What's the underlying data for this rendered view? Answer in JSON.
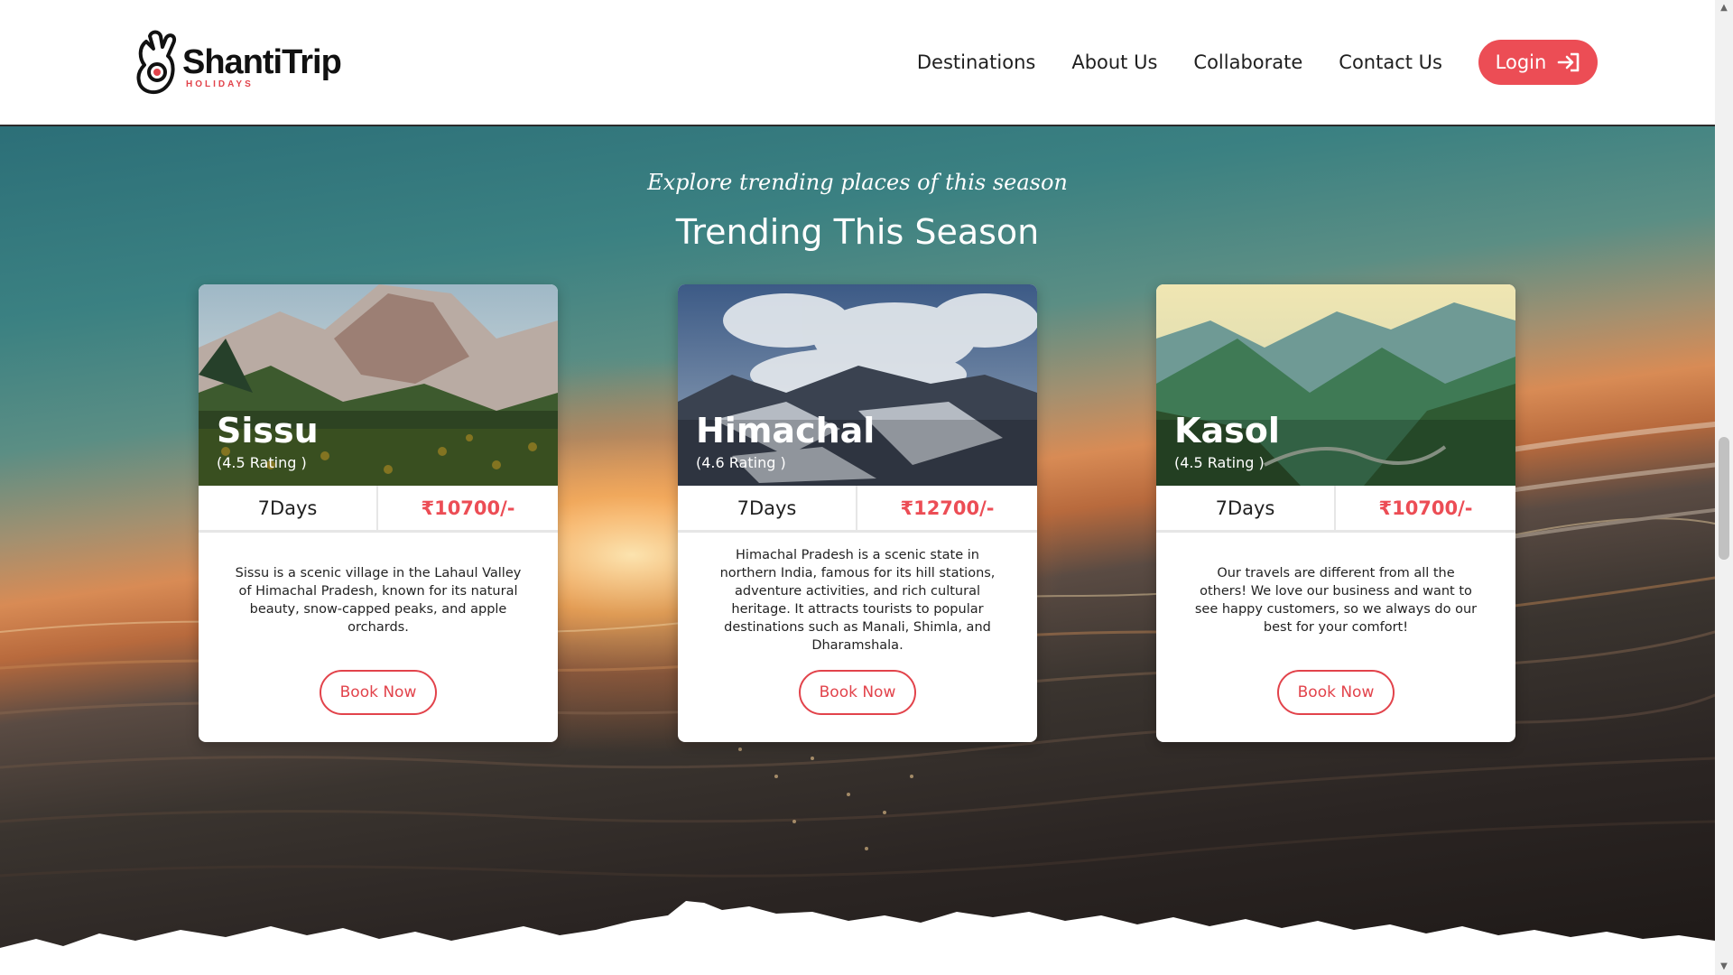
{
  "brand": {
    "name": "ShantiTrip",
    "subtitle": "HOLIDAYS",
    "accent_color": "#ec4d55"
  },
  "nav": {
    "links": [
      "Destinations",
      "About Us",
      "Collaborate",
      "Contact Us"
    ],
    "login_label": "Login",
    "login_icon": "login-arrow-icon"
  },
  "hero": {
    "tagline": "Explore trending places of this season",
    "title": "Trending This Season"
  },
  "cards": [
    {
      "name": "Sissu",
      "rating": "(4.5 Rating )",
      "days": "7Days",
      "price": "₹10700/-",
      "description": "Sissu is a scenic village in the Lahaul Valley of Himachal Pradesh, known for its natural beauty, snow-capped peaks, and apple orchards.",
      "button": "Book Now"
    },
    {
      "name": "Himachal",
      "rating": "(4.6 Rating )",
      "days": "7Days",
      "price": "₹12700/-",
      "description": "Himachal Pradesh is a scenic state in northern India, famous for its hill stations, adventure activities, and rich cultural heritage. It attracts tourists to popular destinations such as Manali, Shimla, and Dharamshala.",
      "button": "Book Now"
    },
    {
      "name": "Kasol",
      "rating": "(4.5 Rating )",
      "days": "7Days",
      "price": "₹10700/-",
      "description": "Our travels are different from all the others! We love our business and want to see happy customers, so we always do our best for your comfort!",
      "button": "Book Now"
    }
  ]
}
